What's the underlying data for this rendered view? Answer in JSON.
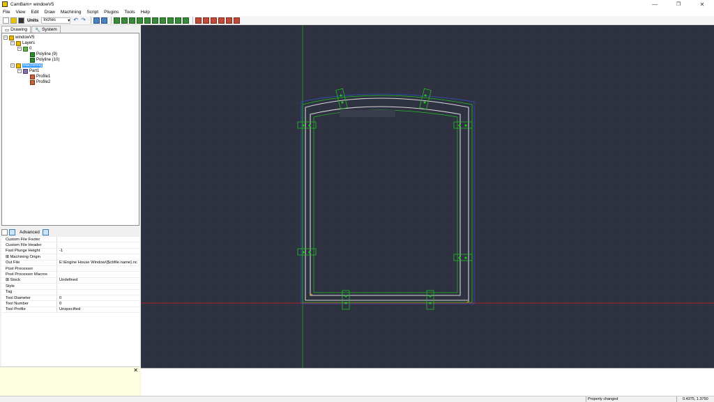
{
  "window": {
    "title": "CamBam+  windowV5"
  },
  "menu": [
    "File",
    "View",
    "Edit",
    "Draw",
    "Machining",
    "Script",
    "Plugins",
    "Tools",
    "Help"
  ],
  "toolbar": {
    "units_label": "Units",
    "units_value": "Inches"
  },
  "tabs": [
    "Drawing",
    "System"
  ],
  "tree": {
    "root": "windowV5",
    "layers": "Layers",
    "layer0": "0",
    "poly9": "Polyline (9)",
    "poly10": "Polyline (10)",
    "machining": "Machining",
    "part1": "Part1",
    "profile1": "Profile1",
    "profile2": "Profile2"
  },
  "props_toolbar": {
    "advanced": "Advanced"
  },
  "properties": [
    {
      "key": "Custom File Footer",
      "value": ""
    },
    {
      "key": "Custom File Header",
      "value": ""
    },
    {
      "key": "Fast Plunge Height",
      "value": "-1"
    },
    {
      "key": "⊞ Machining Origin",
      "value": ""
    },
    {
      "key": "Out File",
      "value": "E:\\Engine House Window\\{$cbfile.name}.nc"
    },
    {
      "key": "Post Processor",
      "value": ""
    },
    {
      "key": "Post Processor Macros",
      "value": ""
    },
    {
      "key": "⊞ Stock",
      "value": "Undefined"
    },
    {
      "key": "Style",
      "value": ""
    },
    {
      "key": "Tag",
      "value": ""
    },
    {
      "key": "Tool Diameter",
      "value": "0"
    },
    {
      "key": "Tool Number",
      "value": "0"
    },
    {
      "key": "Tool Profile",
      "value": "Unspecified"
    }
  ],
  "status": {
    "message": "Property changed",
    "coords": "0.4375, 1.3750"
  },
  "colors": {
    "canvas_bg": "#2e3140",
    "x_axis": "#d02020",
    "y_axis": "#20a020",
    "grid": "#3a3d4c",
    "profile": "#20c020",
    "outline": "#d8d8d8"
  }
}
